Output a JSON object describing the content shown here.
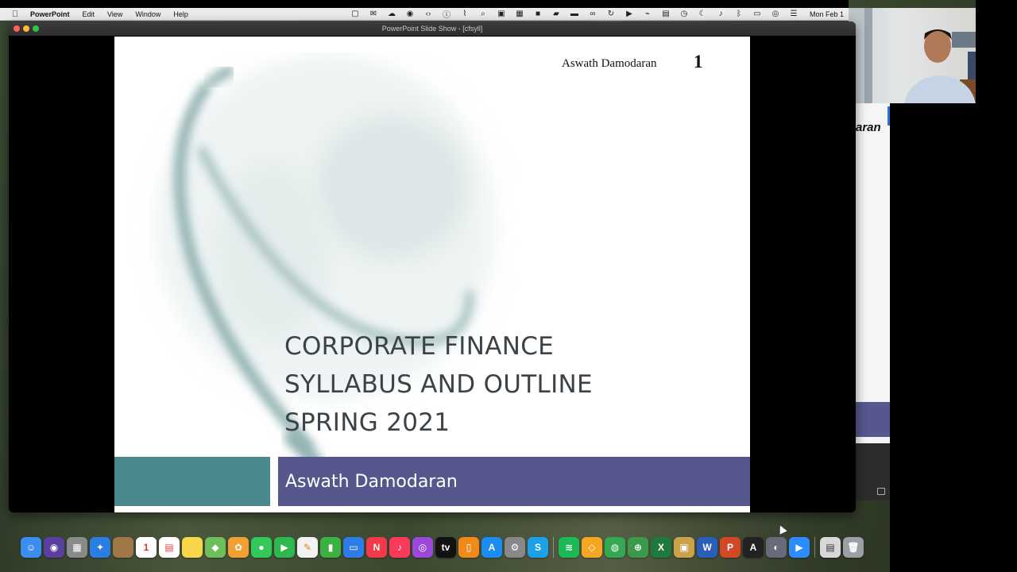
{
  "menubar": {
    "app_name": "PowerPoint",
    "items": [
      "Edit",
      "View",
      "Window",
      "Help"
    ],
    "clock": "Mon Feb 1"
  },
  "window": {
    "title": "PowerPoint Slide Show - [cfsyll]"
  },
  "slide": {
    "header_author": "Aswath Damodaran",
    "number": "1",
    "title_lines": [
      "CORPORATE FINANCE",
      "SYLLABUS AND OUTLINE",
      "SPRING 2021"
    ],
    "footer_author": "Aswath Damodaran"
  },
  "background_window": {
    "partial_text": "aran"
  },
  "colors": {
    "teal_band": "#4a8a8c",
    "purple_band": "#56578c",
    "title_text": "#3c4348"
  },
  "dock": {
    "icons": [
      {
        "name": "finder-icon",
        "glyph": "☺",
        "bg": "#3b8ef0"
      },
      {
        "name": "siri-icon",
        "glyph": "◉",
        "bg": "#5a3fa0"
      },
      {
        "name": "launchpad-icon",
        "glyph": "▦",
        "bg": "#8a8a8a"
      },
      {
        "name": "safari-icon",
        "glyph": "✦",
        "bg": "#2a7de1"
      },
      {
        "name": "contacts-icon",
        "glyph": "",
        "bg": "#a07848"
      },
      {
        "name": "calendar-icon",
        "glyph": "1",
        "bg": "#ffffff",
        "fg": "#d33"
      },
      {
        "name": "reminders-icon",
        "glyph": "▤",
        "bg": "#ffffff",
        "fg": "#e44"
      },
      {
        "name": "notes-icon",
        "glyph": "",
        "bg": "#f7d64a"
      },
      {
        "name": "maps-icon",
        "glyph": "◆",
        "bg": "#6cbf5a"
      },
      {
        "name": "photos-icon",
        "glyph": "✿",
        "bg": "#f0a030"
      },
      {
        "name": "messages-icon",
        "glyph": "●",
        "bg": "#34c759"
      },
      {
        "name": "facetime-icon",
        "glyph": "▶",
        "bg": "#2fb84f"
      },
      {
        "name": "freeform-icon",
        "glyph": "✎",
        "bg": "#f2f2f2",
        "fg": "#d88a20"
      },
      {
        "name": "numbers-icon",
        "glyph": "▮",
        "bg": "#3cb043"
      },
      {
        "name": "keynote-icon",
        "glyph": "▭",
        "bg": "#2e7de6"
      },
      {
        "name": "news-icon",
        "glyph": "N",
        "bg": "#f23a4a"
      },
      {
        "name": "music-icon",
        "glyph": "♪",
        "bg": "#fa3a5a"
      },
      {
        "name": "podcasts-icon",
        "glyph": "◎",
        "bg": "#9b47d9"
      },
      {
        "name": "tv-icon",
        "glyph": "tv",
        "bg": "#111111"
      },
      {
        "name": "books-icon",
        "glyph": "▯",
        "bg": "#f08a1a"
      },
      {
        "name": "appstore-icon",
        "glyph": "A",
        "bg": "#1d8cf0"
      },
      {
        "name": "system-preferences-icon",
        "glyph": "⚙",
        "bg": "#888888"
      },
      {
        "name": "skype-icon",
        "glyph": "S",
        "bg": "#1ea0e8"
      },
      {
        "name": "spotify-icon",
        "glyph": "≋",
        "bg": "#1db954"
      },
      {
        "name": "sketch-icon",
        "glyph": "◇",
        "bg": "#f5a623"
      },
      {
        "name": "chrome-icon",
        "glyph": "◍",
        "bg": "#34a853"
      },
      {
        "name": "globe-app-icon",
        "glyph": "⊕",
        "bg": "#3a9a4a"
      },
      {
        "name": "excel-icon",
        "glyph": "X",
        "bg": "#1d7a3e"
      },
      {
        "name": "archive-icon",
        "glyph": "▣",
        "bg": "#c9a24a"
      },
      {
        "name": "word-icon",
        "glyph": "W",
        "bg": "#2b5eb8"
      },
      {
        "name": "powerpoint-icon",
        "glyph": "P",
        "bg": "#d24726"
      },
      {
        "name": "acrobat-icon",
        "glyph": "A",
        "bg": "#222222"
      },
      {
        "name": "screenshot-icon",
        "glyph": "◐",
        "bg": "#6a6a7a"
      },
      {
        "name": "zoom-icon",
        "glyph": "▶",
        "bg": "#2d8cff"
      },
      {
        "name": "documents-icon",
        "glyph": "▤",
        "bg": "#d8d8d8",
        "fg": "#333"
      },
      {
        "name": "trash-icon",
        "glyph": "🗑",
        "bg": "#9aa0a4"
      }
    ]
  }
}
